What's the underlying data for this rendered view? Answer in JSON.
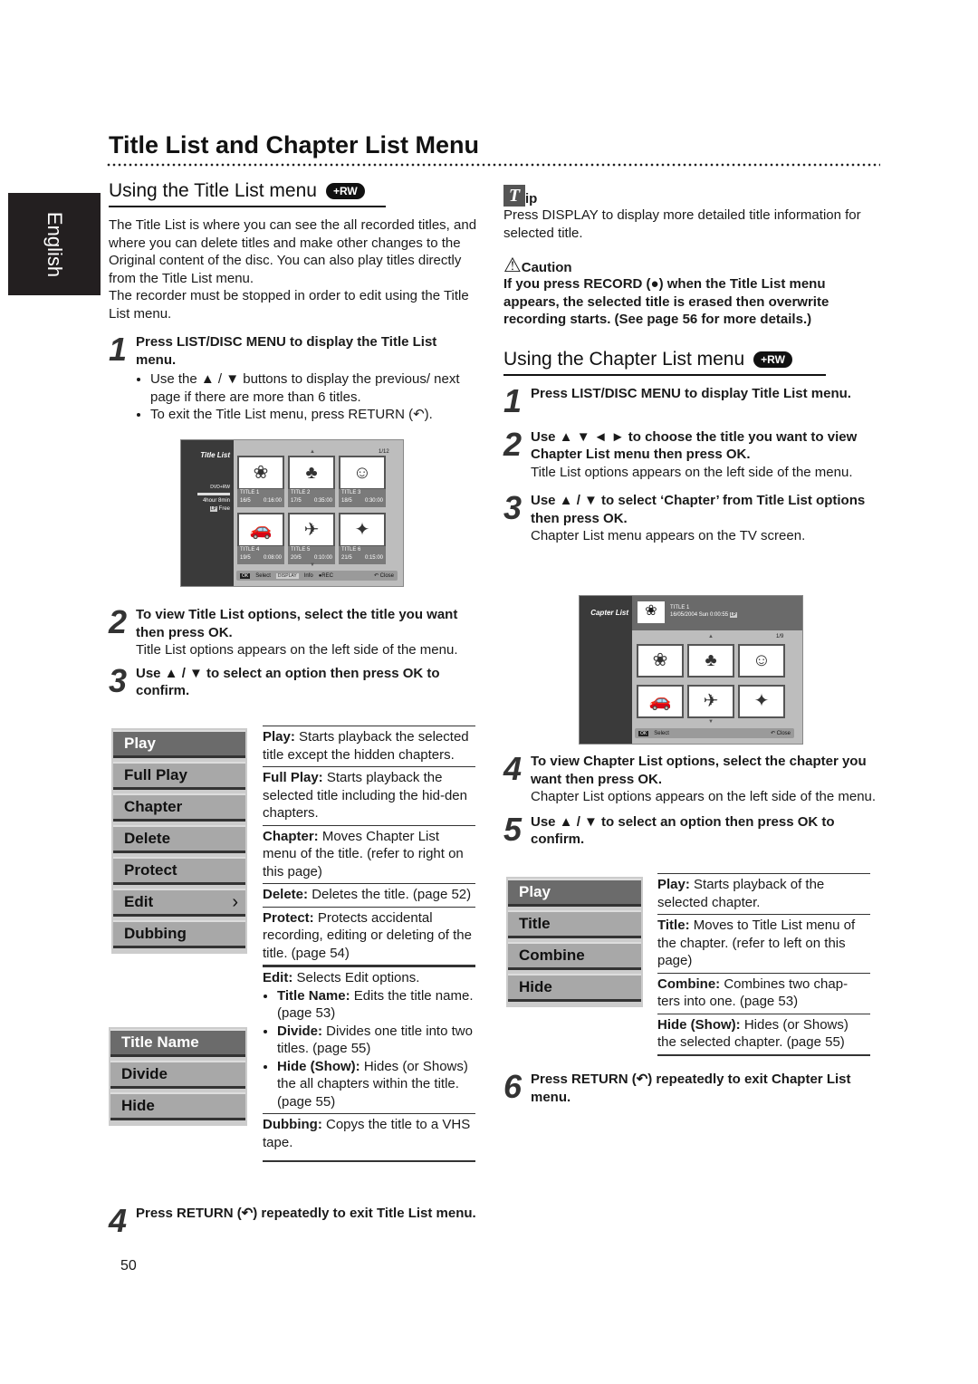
{
  "page_title": "Title List and Chapter List Menu",
  "language_tab": "English",
  "page_number": "50",
  "left": {
    "heading": "Using the Title List menu",
    "badge": "+RW",
    "intro": "The Title List is where you can see the all recorded titles, and where you can delete titles and make other changes to the Original content of the disc. You can also play titles directly from the Title List menu.",
    "intro2": "The recorder must be stopped in order to edit using the Title List menu.",
    "step1": {
      "num": "1",
      "text": "Press LIST/DISC MENU to display the Title List menu.",
      "bullets": [
        "Use the ▲ / ▼ buttons to display the previous/ next page if there are more than 6 titles.",
        "To exit the Title List menu, press RETURN (↶)."
      ]
    },
    "screen": {
      "label": "Title List",
      "disc": "DVD+RW",
      "remaining": "4hour 8min",
      "free_badge": "LP",
      "free": "Free",
      "page": "1/12",
      "titles": [
        {
          "name": "TITLE 1",
          "date": "16/5",
          "len": "0:16:00"
        },
        {
          "name": "TITLE 2",
          "date": "17/5",
          "len": "0:35:00"
        },
        {
          "name": "TITLE 3",
          "date": "18/5",
          "len": "0:30:00"
        },
        {
          "name": "TITLE 4",
          "date": "19/5",
          "len": "0:08:00"
        },
        {
          "name": "TITLE 5",
          "date": "20/5",
          "len": "0:10:00"
        },
        {
          "name": "TITLE 6",
          "date": "21/5",
          "len": "0:15:00"
        }
      ],
      "bar": {
        "ok": "OK",
        "select": "Select",
        "display": "DISPLAY",
        "info": "Info",
        "rec": "●REC",
        "close": "↶ Close"
      }
    },
    "step2": {
      "num": "2",
      "text": "To view Title List options, select the title you want then press OK.",
      "sub": "Title List options appears on the left side of the menu."
    },
    "step3": {
      "num": "3",
      "text": "Use ▲ / ▼ to select an option then press OK to confirm."
    },
    "menu": [
      "Play",
      "Full Play",
      "Chapter",
      "Delete",
      "Protect",
      "Edit",
      "Dubbing"
    ],
    "submenu": [
      "Title Name",
      "Divide",
      "Hide"
    ],
    "descs": [
      {
        "term": "Play:",
        "text": " Starts playback the selected title except the hidden chapters."
      },
      {
        "term": "Full Play:",
        "text": " Starts playback the selected title including the hid-den chapters."
      },
      {
        "term": "Chapter:",
        "text": " Moves Chapter List menu of the title. (refer to right on this page)"
      },
      {
        "term": "Delete:",
        "text": " Deletes the title. (page 52)"
      },
      {
        "term": "Protect:",
        "text": " Protects accidental recording, editing or deleting of the title. (page 54)"
      }
    ],
    "edit_desc": {
      "term": "Edit:",
      "text": " Selects Edit options.",
      "items": [
        {
          "term": "Title Name:",
          "text": " Edits the title name. (page 53)"
        },
        {
          "term": "Divide:",
          "text": " Divides one title into two titles. (page 55)"
        },
        {
          "term": "Hide (Show):",
          "text": " Hides (or Shows) the all chapters within the title. (page 55)"
        }
      ]
    },
    "dub_desc": {
      "term": "Dubbing:",
      "text": " Copys the title to a VHS tape."
    },
    "step4": {
      "num": "4",
      "text": "Press RETURN (↶) repeatedly to exit Title List menu."
    }
  },
  "right": {
    "tip_title": "ip",
    "tip_text": "Press DISPLAY to display more detailed title information for selected title.",
    "caution_title": "Caution",
    "caution_text": "If you press RECORD (●) when the Title List menu appears, the selected title is erased then overwrite recording starts. (See page 56 for more details.)",
    "heading": "Using the Chapter List menu",
    "badge": "+RW",
    "step1": {
      "num": "1",
      "text": "Press LIST/DISC MENU to display Title List menu."
    },
    "step2": {
      "num": "2",
      "text": "Use ▲ ▼ ◄ ► to choose the title you want to view Chapter List menu then press OK.",
      "sub": "Title List options appears on the left side of the menu."
    },
    "step3": {
      "num": "3",
      "text": "Use ▲ / ▼ to select ‘Chapter’ from Title List options then press OK.",
      "sub": "Chapter List menu appears on the TV screen."
    },
    "screen": {
      "label": "Capter List",
      "title": "TITLE 1",
      "info": "16/05/2004 Sun 0:00:55",
      "badge": "LP",
      "page": "1/9",
      "ok": "OK",
      "select": "Select",
      "close": "↶ Close"
    },
    "step4": {
      "num": "4",
      "text": "To view Chapter List options, select the chapter you want then press OK.",
      "sub": "Chapter List options appears on the left side of the menu."
    },
    "step5": {
      "num": "5",
      "text": "Use ▲ / ▼ to select an option then press OK to confirm."
    },
    "menu": [
      "Play",
      "Title",
      "Combine",
      "Hide"
    ],
    "descs": [
      {
        "term": "Play:",
        "text": " Starts playback of the selected chapter."
      },
      {
        "term": "Title:",
        "text": " Moves to Title List menu of the chapter. (refer to left on this page)"
      },
      {
        "term": "Combine:",
        "text": " Combines two chap-ters into one. (page 53)"
      },
      {
        "term": "Hide (Show):",
        "text": " Hides (or Shows) the selected chapter. (page 55)"
      }
    ],
    "step6": {
      "num": "6",
      "text": "Press RETURN (↶) repeatedly to exit Chapter List menu."
    }
  }
}
